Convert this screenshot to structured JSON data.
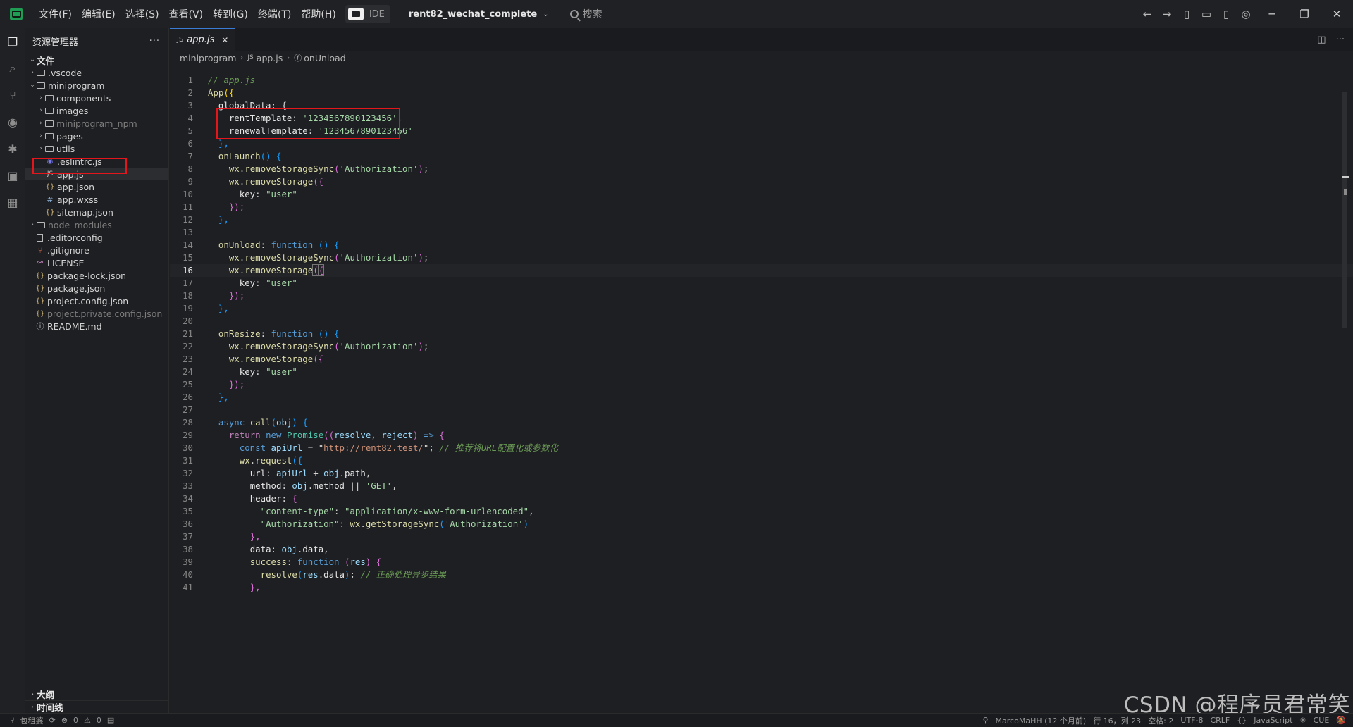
{
  "menu": [
    "文件(F)",
    "编辑(E)",
    "选择(S)",
    "查看(V)",
    "转到(G)",
    "终端(T)",
    "帮助(H)"
  ],
  "ide_label": "IDE",
  "project_name": "rent82_wechat_complete",
  "search_placeholder": "搜索",
  "sidebar": {
    "title": "资源管理器",
    "more": "···",
    "section_files": "文件",
    "items": [
      {
        "label": ".vscode"
      },
      {
        "label": "miniprogram"
      },
      {
        "label": "components"
      },
      {
        "label": "images"
      },
      {
        "label": "miniprogram_npm"
      },
      {
        "label": "pages"
      },
      {
        "label": "utils"
      },
      {
        "label": ".eslintrc.js"
      },
      {
        "label": "app.js"
      },
      {
        "label": "app.json"
      },
      {
        "label": "app.wxss"
      },
      {
        "label": "sitemap.json"
      },
      {
        "label": "node_modules"
      },
      {
        "label": ".editorconfig"
      },
      {
        "label": ".gitignore"
      },
      {
        "label": "LICENSE"
      },
      {
        "label": "package-lock.json"
      },
      {
        "label": "package.json"
      },
      {
        "label": "project.config.json"
      },
      {
        "label": "project.private.config.json"
      },
      {
        "label": "README.md"
      }
    ],
    "outline": "大纲",
    "timeline": "时间线"
  },
  "editor": {
    "tab_icon": "JS",
    "tab_label": "app.js",
    "breadcrumb": {
      "folder": "miniprogram",
      "file_icon": "JS",
      "file": "app.js",
      "symbol": "onUnload"
    },
    "line_numbers": [
      "1",
      "2",
      "3",
      "4",
      "5",
      "6",
      "7",
      "8",
      "9",
      "10",
      "11",
      "12",
      "13",
      "14",
      "15",
      "16",
      "17",
      "18",
      "19",
      "20",
      "21",
      "22",
      "23",
      "24",
      "25",
      "26",
      "27",
      "28",
      "29",
      "30",
      "31",
      "32",
      "33",
      "34",
      "35",
      "36",
      "37",
      "38",
      "39",
      "40",
      "41"
    ],
    "current_line": 16
  },
  "code": {
    "l1": "// app.js",
    "l2_fn": "App",
    "l2_rest": "({",
    "l3_key": "globalData",
    "l3_rest": ": {",
    "l4_key": "rentTemplate",
    "l4_val": "'1234567890123456'",
    "l5_key": "renewalTemplate",
    "l5_val": "'1234567890123456'",
    "l6": "},",
    "l7_fn": "onLaunch",
    "l7_rest": "() {",
    "l8_obj": "wx",
    "l8_fn": "removeStorageSync",
    "l8_str": "'Authorization'",
    "l9_obj": "wx",
    "l9_fn": "removeStorage",
    "l10_key": "key",
    "l10_val": "\"user\"",
    "l11": "});",
    "l12": "},",
    "l14_fn": "onUnload",
    "l14_kw": "function",
    "l15_obj": "wx",
    "l15_fn": "removeStorageSync",
    "l15_str": "'Authorization'",
    "l16_obj": "wx",
    "l16_fn": "removeStorage",
    "l17_key": "key",
    "l17_val": "\"user\"",
    "l18": "});",
    "l19": "},",
    "l21_fn": "onResize",
    "l21_kw": "function",
    "l22_obj": "wx",
    "l22_fn": "removeStorageSync",
    "l22_str": "'Authorization'",
    "l23_obj": "wx",
    "l23_fn": "removeStorage",
    "l24_key": "key",
    "l24_val": "\"user\"",
    "l25": "});",
    "l26": "},",
    "l28_kw": "async",
    "l28_fn": "call",
    "l28_arg": "obj",
    "l29_kw": "return",
    "l29_kw2": "new",
    "l29_cls": "Promise",
    "l29_a": "resolve",
    "l29_b": "reject",
    "l30_kw": "const",
    "l30_var": "apiUrl",
    "l30_url": "http://rent82.test/",
    "l30_com": "// 推荐将URL配置化或参数化",
    "l31_obj": "wx",
    "l31_fn": "request",
    "l32_key": "url",
    "l32_a": "apiUrl",
    "l32_b": "obj",
    "l32_c": "path",
    "l33_key": "method",
    "l33_a": "obj",
    "l33_b": "method",
    "l33_str": "'GET'",
    "l34_key": "header",
    "l35_key": "\"content-type\"",
    "l35_val": "\"application/x-www-form-urlencoded\"",
    "l36_key": "\"Authorization\"",
    "l36_obj": "wx",
    "l36_fn": "getStorageSync",
    "l36_str": "'Authorization'",
    "l37": "},",
    "l38_key": "data",
    "l38_a": "obj",
    "l38_b": "data",
    "l39_key": "success",
    "l39_kw": "function",
    "l39_arg": "res",
    "l40_fn": "resolve",
    "l40_a": "res",
    "l40_b": "data",
    "l40_com": "// 正确处理异步结果",
    "l41": "},"
  },
  "statusbar": {
    "branch": "包租婆",
    "problems_errors": "0",
    "problems_warnings": "0",
    "author": "MarcoMaHH (12 个月前)",
    "position": "行 16，列 23",
    "indent": "空格: 2",
    "encoding": "UTF-8",
    "eol": "CRLF",
    "language": "JavaScript",
    "extra": "CUE"
  },
  "watermark": "CSDN @程序员君常笑",
  "colors": {
    "highlight_box": "#e5161b",
    "accent": "#3a7bd5"
  }
}
